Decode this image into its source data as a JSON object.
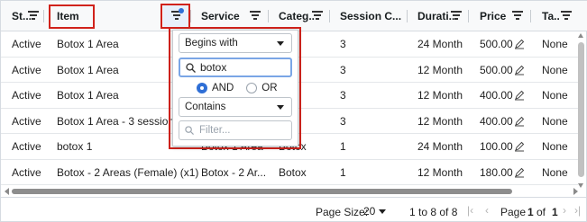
{
  "columns": [
    {
      "label": "St..."
    },
    {
      "label": "Item"
    },
    {
      "label": ""
    },
    {
      "label": "Service"
    },
    {
      "label": "Categ..."
    },
    {
      "label": "Session C..."
    },
    {
      "label": "Durati..."
    },
    {
      "label": "Price"
    },
    {
      "label": ""
    },
    {
      "label": "Ta..."
    }
  ],
  "rows": [
    {
      "status": "Active",
      "item": "Botox 1 Area",
      "service": "",
      "category": "",
      "sessions": "3",
      "duration": "24 Month",
      "price": "500.00",
      "tax": "None"
    },
    {
      "status": "Active",
      "item": "Botox 1 Area",
      "service": "",
      "category": "",
      "sessions": "3",
      "duration": "12 Month",
      "price": "500.00",
      "tax": "None"
    },
    {
      "status": "Active",
      "item": "Botox 1 Area",
      "service": "",
      "category": "",
      "sessions": "3",
      "duration": "12 Month",
      "price": "400.00",
      "tax": "None"
    },
    {
      "status": "Active",
      "item": "Botox 1 Area - 3 sessions",
      "service": "",
      "category": "",
      "sessions": "3",
      "duration": "12 Month",
      "price": "400.00",
      "tax": "None"
    },
    {
      "status": "Active",
      "item": "botox 1",
      "service": "Botox 1 Area",
      "category": "Botox",
      "sessions": "1",
      "duration": "24 Month",
      "price": "100.00",
      "tax": "None"
    },
    {
      "status": "Active",
      "item": "Botox - 2 Areas (Female) (x1)",
      "service": "Botox - 2 Ar...",
      "category": "Botox",
      "sessions": "1",
      "duration": "12 Month",
      "price": "180.00",
      "tax": "None"
    }
  ],
  "filter_popup": {
    "condition1": "Begins with",
    "search_value": "botox",
    "join_and": "AND",
    "join_or": "OR",
    "join_selected": "AND",
    "condition2": "Contains",
    "filter_placeholder": "Filter..."
  },
  "footer": {
    "page_size_label": "Page Size:",
    "page_size_value": "20",
    "row_range": "1 to 8 of 8",
    "page_text_prefix": "Page",
    "page_current": "1",
    "page_of": "of",
    "page_total": "1"
  },
  "colors": {
    "highlight": "#d1221b",
    "accent": "#2f6fd6"
  }
}
